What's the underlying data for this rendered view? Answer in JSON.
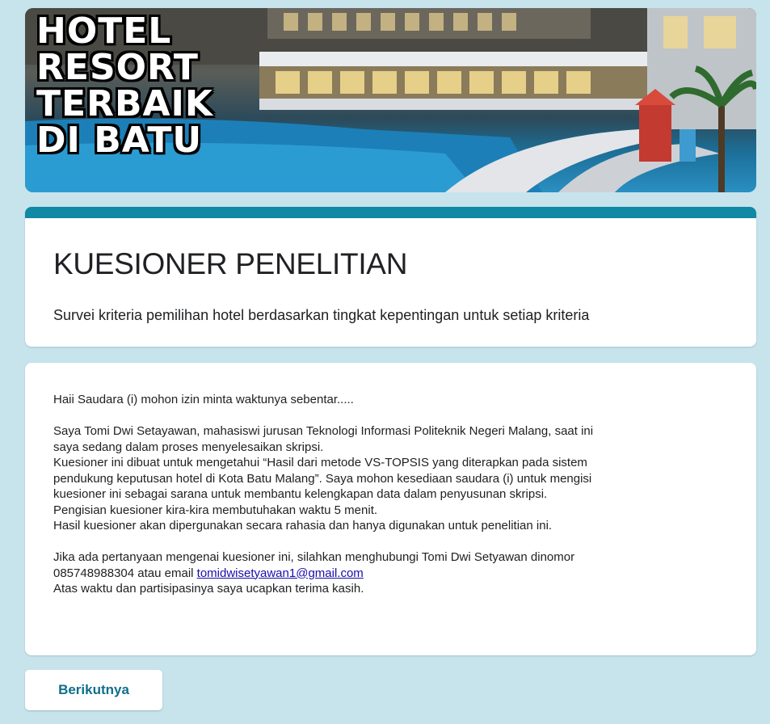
{
  "banner": {
    "lines": [
      "HOTEL",
      "RESORT",
      "TERBAIK",
      "DI BATU"
    ]
  },
  "form": {
    "title": "KUESIONER PENELITIAN",
    "subtitle": "Survei kriteria pemilihan hotel berdasarkan tingkat kepentingan untuk setiap kriteria"
  },
  "description": {
    "greeting": "Haii  Saudara (i)  mohon izin minta waktunya sebentar.....",
    "p1_l1": "Saya Tomi Dwi Setayawan, mahasiswi jurusan Teknologi Informasi Politeknik Negeri Malang, saat ini",
    "p1_l2": "saya sedang dalam proses menyelesaikan skripsi.",
    "p1_l3": "Kuesioner ini dibuat untuk mengetahui “Hasil dari metode VS-TOPSIS yang diterapkan pada sistem",
    "p1_l4": "pendukung keputusan hotel di Kota Batu Malang”. Saya mohon kesediaan saudara (i) untuk mengisi",
    "p1_l5": "kuesioner ini sebagai sarana untuk membantu kelengkapan data dalam penyusunan skripsi.",
    "p1_l6": "Pengisian kuesioner kira-kira membutuhakan waktu 5 menit.",
    "p1_l7": "Hasil kuesioner akan dipergunakan secara rahasia dan hanya digunakan untuk penelitian ini.",
    "p2_l1": "Jika ada pertanyaan mengenai kuesioner ini, silahkan menghubungi Tomi Dwi Setyawan dinomor",
    "p2_l2_prefix": "085748988304 atau email ",
    "email": "tomidwisetyawan1@gmail.com",
    "p2_l3": "Atas waktu dan partisipasinya saya ucapkan terima kasih."
  },
  "buttons": {
    "next": "Berikutnya"
  },
  "colors": {
    "background": "#c7e4ec",
    "accent": "#1188a4",
    "link": "#1a0dab"
  }
}
